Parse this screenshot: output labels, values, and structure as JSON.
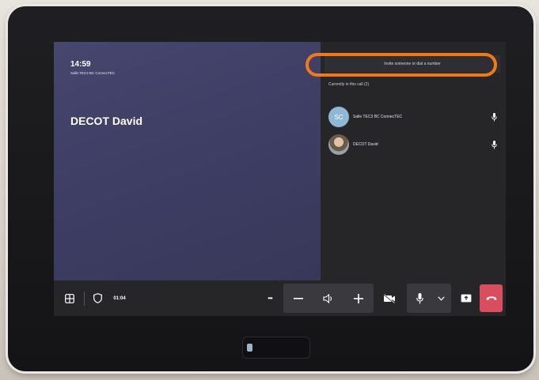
{
  "call": {
    "clock": "14:59",
    "room_name": "Salle TEC3 BC ConnecTEC",
    "caller_name": "DECOT David",
    "duration": "01:04"
  },
  "side_panel": {
    "invite_placeholder": "Invite someone or dial a number",
    "participants_header": "Currently in this call (2)",
    "participants": [
      {
        "initials": "SC",
        "name": "Salle TEC3 BC ConnecTEC",
        "avatar": "initials"
      },
      {
        "initials": "",
        "name": "DECOT David",
        "avatar": "photo"
      }
    ]
  },
  "toolbar": {
    "more_label": "•••",
    "icons": [
      "layout-grid-icon",
      "shield-icon",
      "more-icon",
      "volume-down-icon",
      "speaker-icon",
      "volume-up-icon",
      "video-off-icon",
      "mic-icon",
      "chevron-down-icon",
      "share-screen-icon",
      "end-call-icon"
    ]
  },
  "colors": {
    "highlight": "#f07a1a",
    "main_panel": "#3f3f66",
    "side_panel": "#262629",
    "end_call": "#d94e5f"
  }
}
